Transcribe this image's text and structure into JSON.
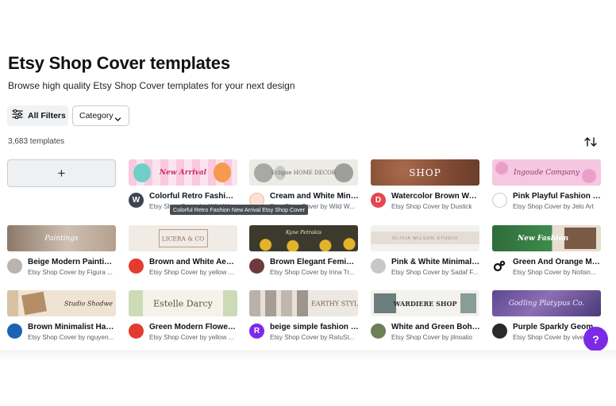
{
  "page": {
    "title": "Etsy Shop Cover templates",
    "subtitle": "Browse high quality Etsy Shop Cover templates for your next design",
    "filters_label": "All Filters",
    "category_label": "Category",
    "count": "3,683 templates",
    "add_symbol": "+",
    "tooltip": "Colorful Retro Fashion New Arrival Etsy Shop Cover",
    "help_symbol": "?"
  },
  "templates": [
    {
      "title": "Colorful Retro Fashion ...",
      "subtitle": "Etsy Shop Cover by Wild W...",
      "thumb_text": "New Arrival",
      "avatar_text": "W"
    },
    {
      "title": "Cream and White Mini...",
      "subtitle": "Etsy Shop Cover by Wild W...",
      "thumb_text": "Eclipse HOME DECOR",
      "avatar_text": ""
    },
    {
      "title": "Watercolor Brown Wat...",
      "subtitle": "Etsy Shop Cover by Dustick",
      "thumb_text": "SHOP",
      "avatar_text": "D"
    },
    {
      "title": "Pink Playful Fashion Et...",
      "subtitle": "Etsy Shop Cover by Jelo Art",
      "thumb_text": "Ingoude Company",
      "avatar_text": ""
    },
    {
      "title": "Beige Modern Painting...",
      "subtitle": "Etsy Shop Cover by Figura ...",
      "thumb_text": "Paintings",
      "avatar_text": ""
    },
    {
      "title": "Brown and White Aest...",
      "subtitle": "Etsy Shop Cover by yellow ...",
      "thumb_text": "LICERA & CO",
      "avatar_text": ""
    },
    {
      "title": "Brown Elegant Feminin...",
      "subtitle": "Etsy Shop Cover by Irina Tr...",
      "thumb_text": "Kyne Petrakis",
      "avatar_text": ""
    },
    {
      "title": "Pink & White Minimalis...",
      "subtitle": "Etsy Shop Cover by Sadaf F...",
      "thumb_text": "OLIVIA WILSON STUDIO",
      "avatar_text": ""
    },
    {
      "title": "Green And Orange Mo...",
      "subtitle": "Etsy Shop Cover by Notisn...",
      "thumb_text": "New Fashion",
      "avatar_text": ""
    },
    {
      "title": "Brown Minimalist Han...",
      "subtitle": "Etsy Shop Cover by nguyen...",
      "thumb_text": "Studio Shodwe",
      "avatar_text": ""
    },
    {
      "title": "Green Modern Flower ...",
      "subtitle": "Etsy Shop Cover by yellow ...",
      "thumb_text": "Estelle Darcy",
      "avatar_text": ""
    },
    {
      "title": "beige simple fashion st...",
      "subtitle": "Etsy Shop Cover by RatuSt...",
      "thumb_text": "EARTHY STYLE",
      "avatar_text": "R"
    },
    {
      "title": "White and Green Boho ...",
      "subtitle": "Etsy Shop Cover by jilnoalio",
      "thumb_text": "WARDIERE SHOP",
      "avatar_text": ""
    },
    {
      "title": "Purple Sparkly Geome...",
      "subtitle": "Etsy Shop Cover by vive...",
      "thumb_text": "Godling Platypus Co.",
      "avatar_text": ""
    }
  ],
  "colors": {
    "accent": "#7d2ae8",
    "text": "#0d1216",
    "muted": "#5a6068"
  }
}
